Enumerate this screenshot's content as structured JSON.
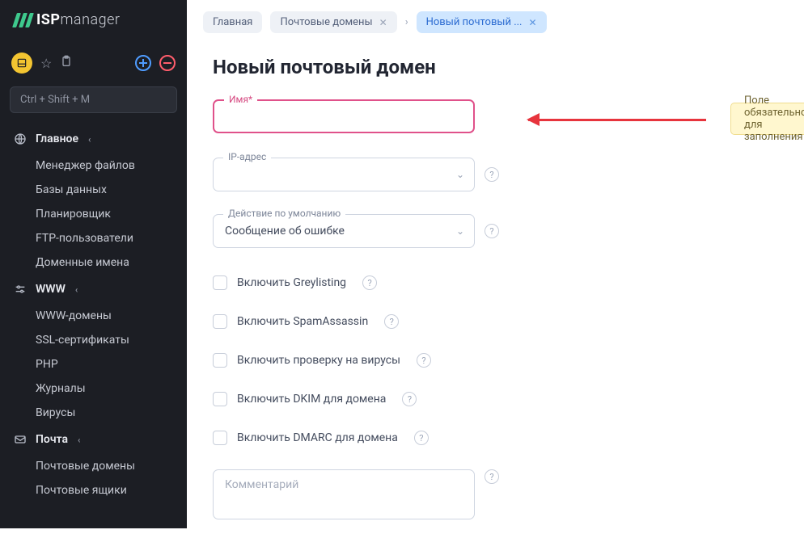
{
  "logo": {
    "strong": "ISP",
    "light": "manager"
  },
  "toolbar": {
    "search_placeholder": "Ctrl + Shift + M"
  },
  "nav": {
    "group1": {
      "title": "Главное",
      "icon": "globe",
      "items": [
        "Менеджер файлов",
        "Базы данных",
        "Планировщик",
        "FTP-пользователи",
        "Доменные имена"
      ]
    },
    "group2": {
      "title": "WWW",
      "icon": "sliders",
      "items": [
        "WWW-домены",
        "SSL-сертификаты",
        "PHP",
        "Журналы",
        "Вирусы"
      ]
    },
    "group3": {
      "title": "Почта",
      "icon": "mail",
      "items": [
        "Почтовые домены",
        "Почтовые ящики"
      ]
    }
  },
  "breadcrumbs": {
    "home": "Главная",
    "b1": "Почтовые домены",
    "b2": "Новый почтовый ..."
  },
  "page_title": "Новый почтовый домен",
  "form": {
    "name_label": "Имя*",
    "ip_label": "IP-адрес",
    "action_label": "Действие по умолчанию",
    "action_value": "Сообщение об ошибке",
    "greylisting": "Включить Greylisting",
    "spamassassin": "Включить SpamAssassin",
    "virus": "Включить проверку на вирусы",
    "dkim": "Включить DKIM для домена",
    "dmarc": "Включить DMARC для домена",
    "comment_placeholder": "Комментарий"
  },
  "tooltip": {
    "text": "Поле обязательно для заполнения"
  }
}
